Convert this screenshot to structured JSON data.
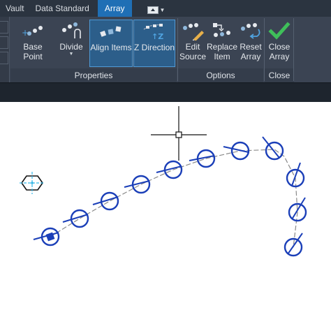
{
  "tabs": [
    {
      "label": "Vault"
    },
    {
      "label": "Data Standard"
    },
    {
      "label": "Array"
    }
  ],
  "ribbon": {
    "panels": {
      "properties": "Properties",
      "options": "Options",
      "close": "Close"
    },
    "buttons": {
      "base_point": "Base Point",
      "divide": "Divide",
      "align_items": "Align Items",
      "z_direction": "Z Direction",
      "edit_source_1": "Edit",
      "edit_source_2": "Source",
      "replace_item_1": "Replace",
      "replace_item_2": "Item",
      "reset_array_1": "Reset",
      "reset_array_2": "Array",
      "close_array_1": "Close",
      "close_array_2": "Array"
    },
    "icons": {
      "base_point": "base-point-icon",
      "divide": "divide-icon",
      "align_items": "align-items-icon",
      "z_direction": "z-direction-icon",
      "edit_source": "edit-source-icon",
      "replace_item": "replace-item-icon",
      "reset_array": "reset-array-icon",
      "close_array": "checkmark-icon"
    },
    "colors": {
      "tab_active": "#1f6fb5",
      "ribbon_bg": "#3b4453",
      "selected_button": "#2c5e8a",
      "close_check": "#3fbf5a",
      "array_item_stroke": "#1b3fb8",
      "path": "#8a8a8a"
    }
  }
}
